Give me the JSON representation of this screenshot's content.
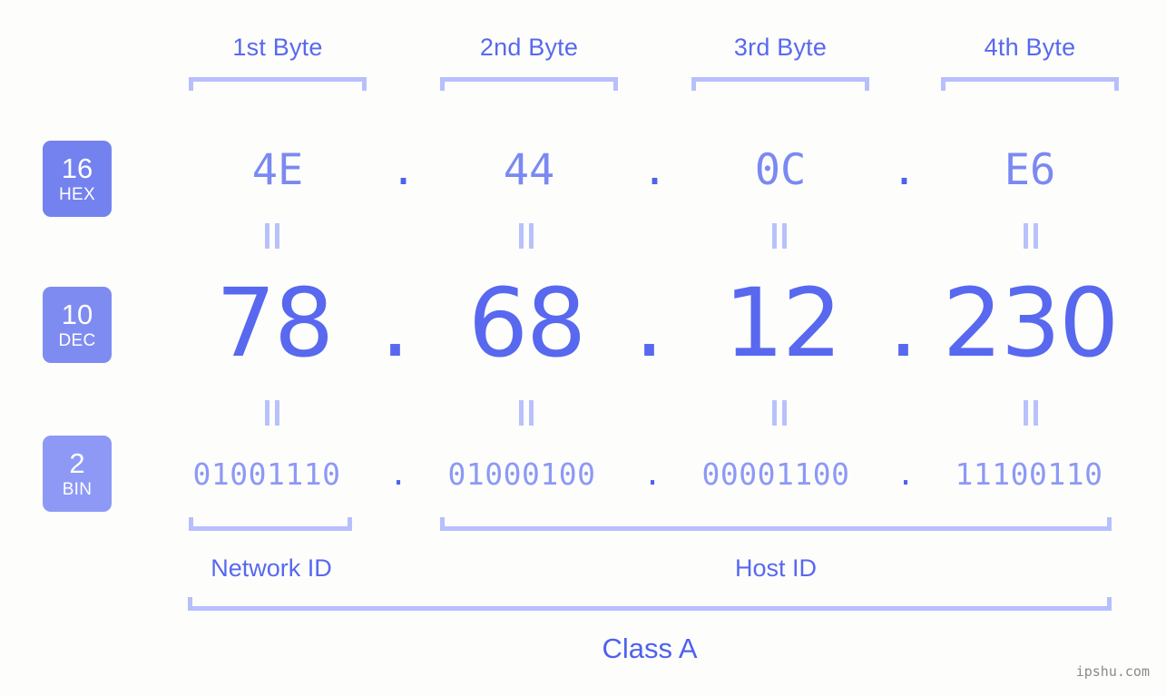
{
  "meta": {
    "background_color": "#fdfefb",
    "accent_color": "#5868ef",
    "accent_light": "#b7bffc",
    "badge_color": "#7382ef",
    "badge_color_light": "#8d99f5",
    "watermark": "ipshu.com"
  },
  "byte_headers": [
    {
      "label": "1st Byte"
    },
    {
      "label": "2nd Byte"
    },
    {
      "label": "3rd Byte"
    },
    {
      "label": "4th Byte"
    }
  ],
  "bases": [
    {
      "num": "16",
      "name": "HEX"
    },
    {
      "num": "10",
      "name": "DEC"
    },
    {
      "num": "2",
      "name": "BIN"
    }
  ],
  "rows": {
    "hex": {
      "base": "16",
      "base_name": "HEX",
      "values": [
        "4E",
        "44",
        "0C",
        "E6"
      ],
      "separator": "."
    },
    "dec": {
      "base": "10",
      "base_name": "DEC",
      "values": [
        "78",
        "68",
        "12",
        "230"
      ],
      "separator": "."
    },
    "bin": {
      "base": "2",
      "base_name": "BIN",
      "values": [
        "01001110",
        "01000100",
        "00001100",
        "11100110"
      ],
      "separator": "."
    }
  },
  "equals_marks": {
    "symbol": "||",
    "count_per_gap": 4
  },
  "id_split": {
    "network": {
      "label": "Network ID",
      "bytes": 1
    },
    "host": {
      "label": "Host ID",
      "bytes": 3
    }
  },
  "ip_class": {
    "label": "Class A"
  },
  "ip_address": {
    "dec": "78.68.12.230",
    "hex": "4E.44.0C.E6",
    "bin": "01001110.01000100.00001100.11100110"
  }
}
